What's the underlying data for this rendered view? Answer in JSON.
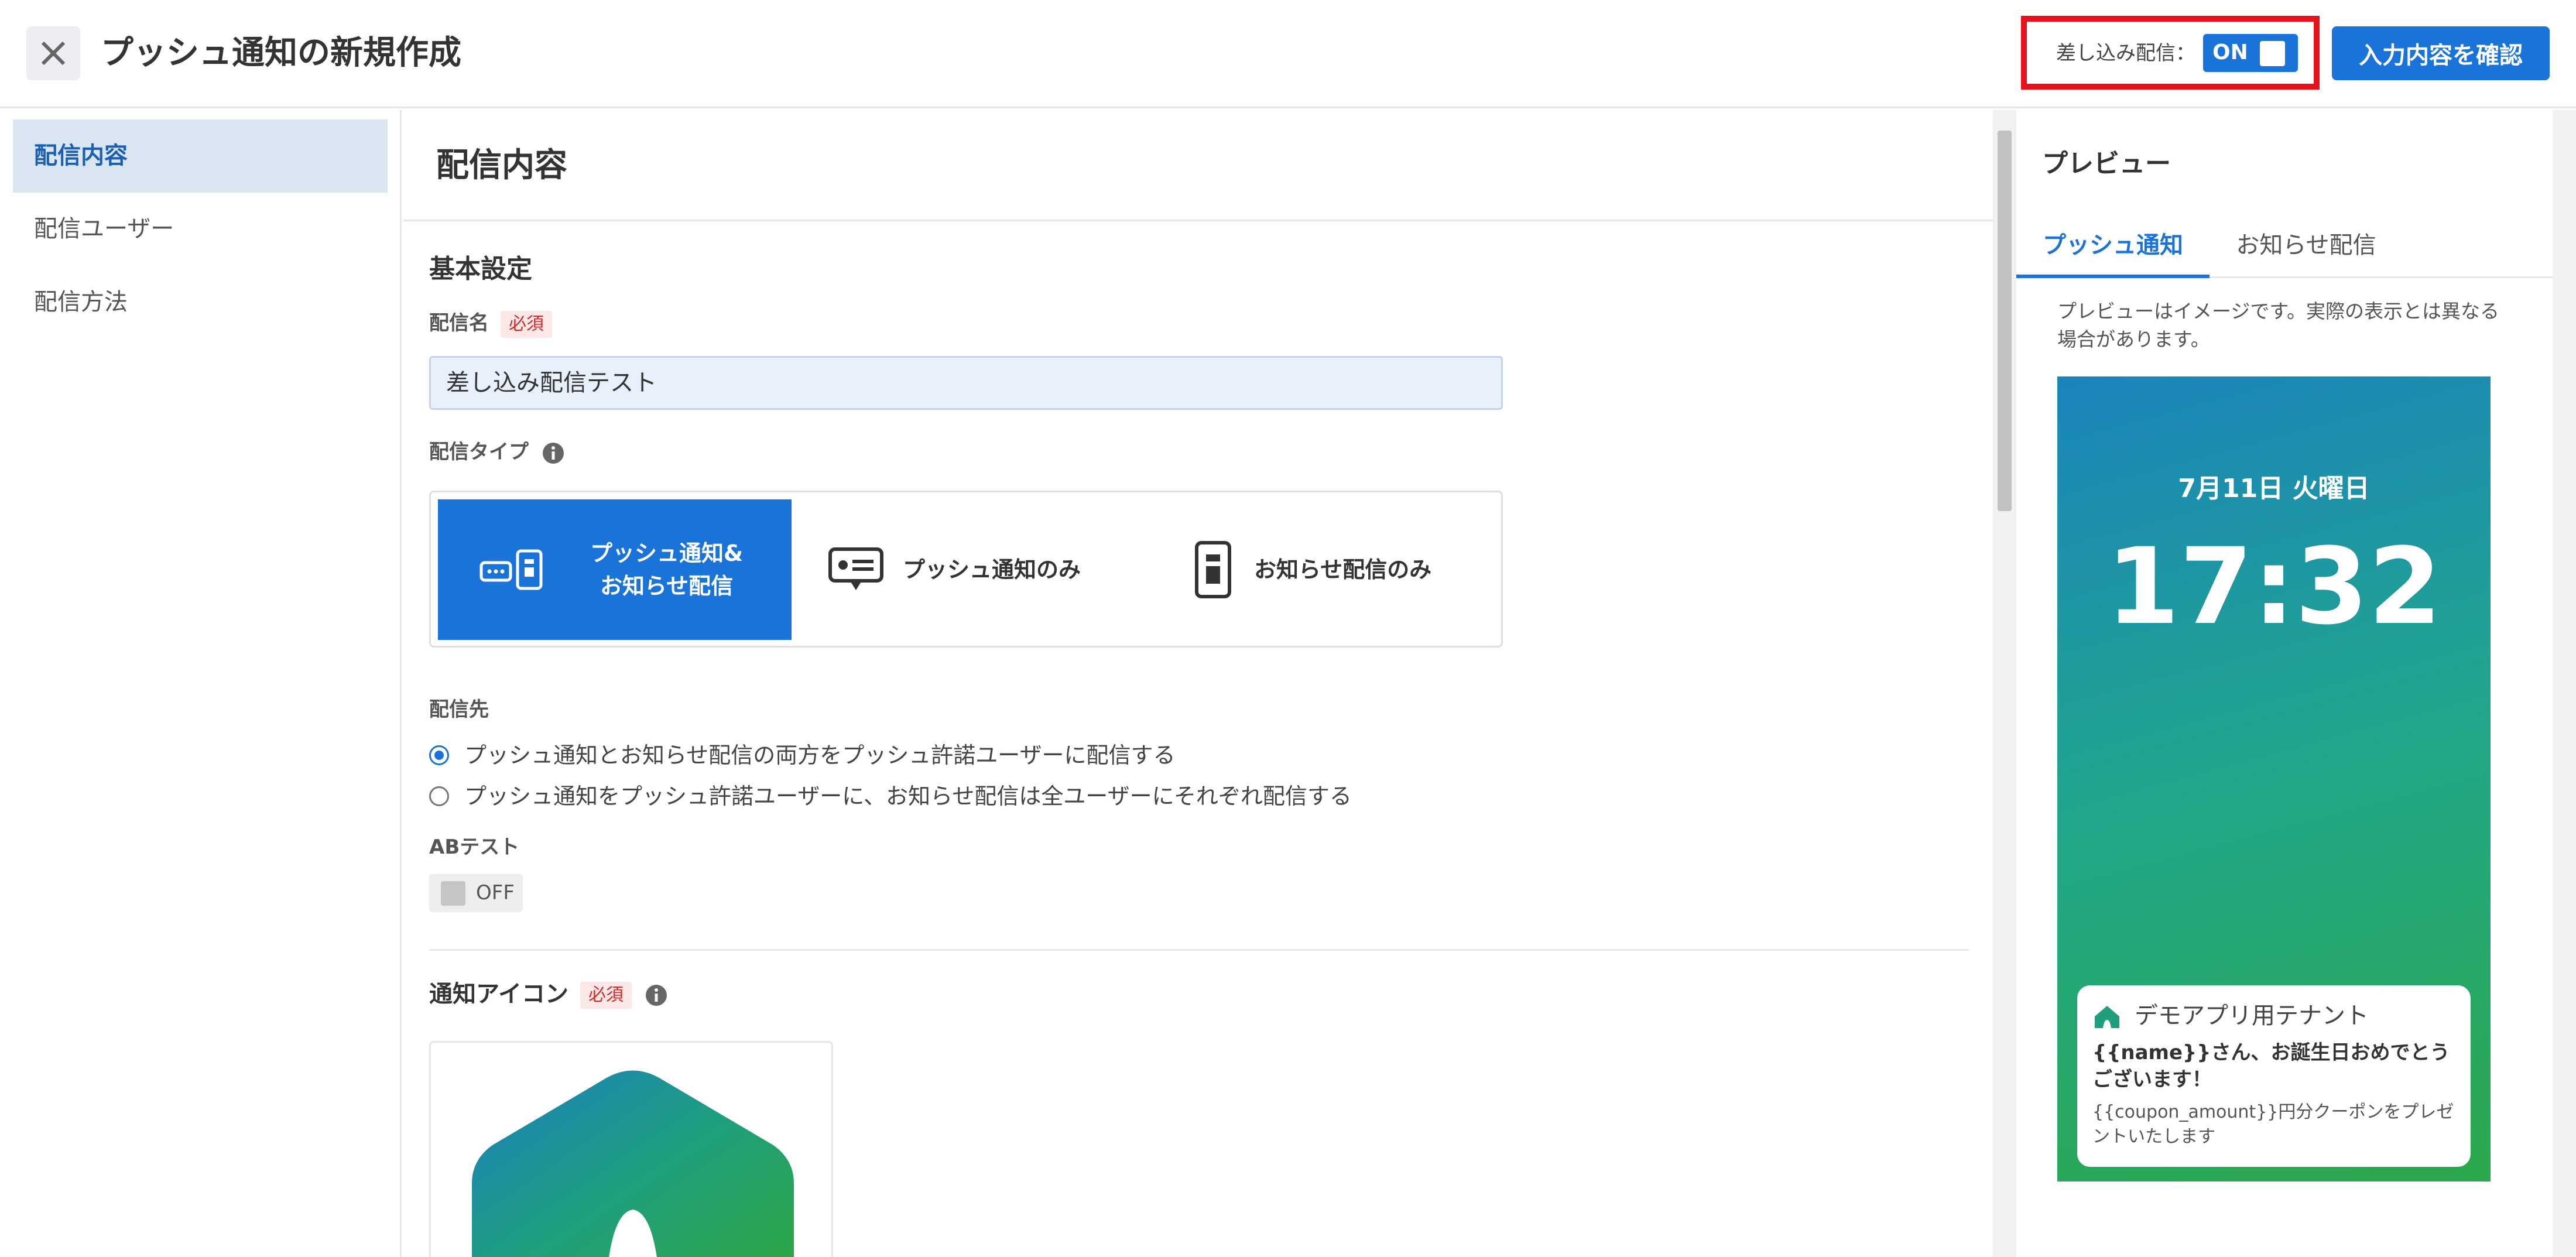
{
  "header": {
    "title": "プッシュ通知の新規作成",
    "insert_label": "差し込み配信：",
    "insert_toggle": "ON",
    "confirm_label": "入力内容を確認"
  },
  "sidebar": {
    "items": [
      {
        "label": "配信内容",
        "active": true
      },
      {
        "label": "配信ユーザー",
        "active": false
      },
      {
        "label": "配信方法",
        "active": false
      }
    ]
  },
  "main": {
    "title": "配信内容",
    "basic_section": "基本設定",
    "name_label": "配信名",
    "required_badge": "必須",
    "name_value": "差し込み配信テスト",
    "type_label": "配信タイプ",
    "types": [
      {
        "line1": "プッシュ通知&",
        "line2": "お知らせ配信",
        "selected": true
      },
      {
        "line1": "プッシュ通知のみ",
        "selected": false
      },
      {
        "line1": "お知らせ配信のみ",
        "selected": false
      }
    ],
    "destination_label": "配信先",
    "destinations": [
      {
        "label": "プッシュ通知とお知らせ配信の両方をプッシュ許諾ユーザーに配信する",
        "checked": true
      },
      {
        "label": "プッシュ通知をプッシュ許諾ユーザーに、お知らせ配信は全ユーザーにそれぞれ配信する",
        "checked": false
      }
    ],
    "ab_label": "ABテスト",
    "ab_toggle": "OFF",
    "icon_label": "通知アイコン"
  },
  "preview": {
    "title": "プレビュー",
    "tabs": [
      {
        "label": "プッシュ通知",
        "active": true
      },
      {
        "label": "お知らせ配信",
        "active": false
      }
    ],
    "note": "プレビューはイメージです。実際の表示とは異なる場合があります。",
    "date": "7月11日 火曜日",
    "time": "17:32",
    "notification": {
      "app_name": "デモアプリ用テナント",
      "title": "{{name}}さん、お誕生日おめでとうございます！",
      "body": "{{coupon_amount}}円分クーポンをプレゼントいたします"
    }
  },
  "colors": {
    "accent": "#1a73d9",
    "highlight_border": "#e8111e",
    "required": "#d12b2b"
  }
}
